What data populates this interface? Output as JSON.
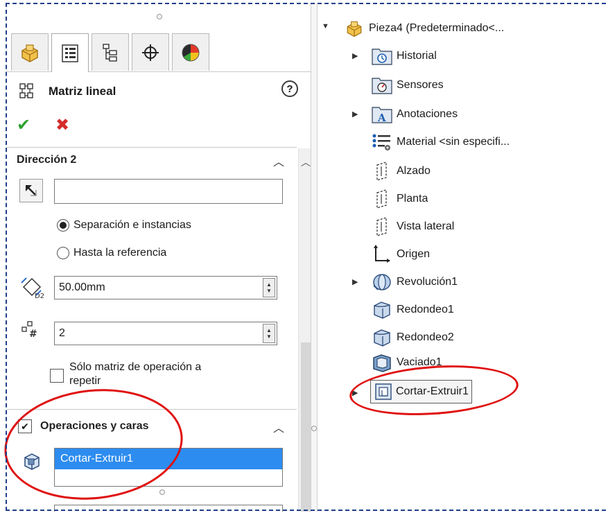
{
  "property_manager": {
    "title": "Matriz lineal",
    "help_glyph": "?",
    "ok_glyph": "✔",
    "cancel_glyph": "✖",
    "tabs": [
      {
        "icon": "part-icon"
      },
      {
        "icon": "property-manager-icon"
      },
      {
        "icon": "configuration-manager-icon"
      },
      {
        "icon": "dimxpert-icon"
      },
      {
        "icon": "display-manager-icon"
      }
    ],
    "direction2": {
      "title": "Dirección 2",
      "direction_value": "",
      "option_spacing": "Separación e instancias",
      "option_reference": "Hasta la referencia",
      "spacing_value": "50.00mm",
      "instances_value": "2",
      "only_seed_label_line1": "Sólo matriz de operación a",
      "only_seed_label_line2": "repetir"
    },
    "features_faces": {
      "title": "Operaciones y caras",
      "checked": true,
      "items": [
        "Cortar-Extruir1"
      ]
    }
  },
  "feature_tree": {
    "items": [
      {
        "label": "Pieza4  (Predeterminado<...",
        "icon": "part-icon",
        "arrow": "expanded"
      },
      {
        "label": "Historial",
        "icon": "history-folder-icon",
        "arrow": "collapsed"
      },
      {
        "label": "Sensores",
        "icon": "sensors-folder-icon",
        "arrow": ""
      },
      {
        "label": "Anotaciones",
        "icon": "annotations-folder-icon",
        "arrow": "collapsed"
      },
      {
        "label": "Material <sin especifi...",
        "icon": "material-icon",
        "arrow": ""
      },
      {
        "label": "Alzado",
        "icon": "plane-icon",
        "arrow": ""
      },
      {
        "label": "Planta",
        "icon": "plane-icon",
        "arrow": ""
      },
      {
        "label": "Vista lateral",
        "icon": "plane-icon",
        "arrow": ""
      },
      {
        "label": "Origen",
        "icon": "origin-icon",
        "arrow": ""
      },
      {
        "label": "Revolución1",
        "icon": "revolve-icon",
        "arrow": "collapsed"
      },
      {
        "label": "Redondeo1",
        "icon": "fillet-icon",
        "arrow": ""
      },
      {
        "label": "Redondeo2",
        "icon": "fillet-icon",
        "arrow": ""
      },
      {
        "label": "Vaciado1",
        "icon": "shell-icon",
        "arrow": ""
      },
      {
        "label": "Cortar-Extruir1",
        "icon": "cut-extrude-icon",
        "arrow": "collapsed"
      }
    ]
  },
  "colors": {
    "frame": "#1f3e8c",
    "highlight": "#e01010",
    "selection": "#2d8cef"
  }
}
